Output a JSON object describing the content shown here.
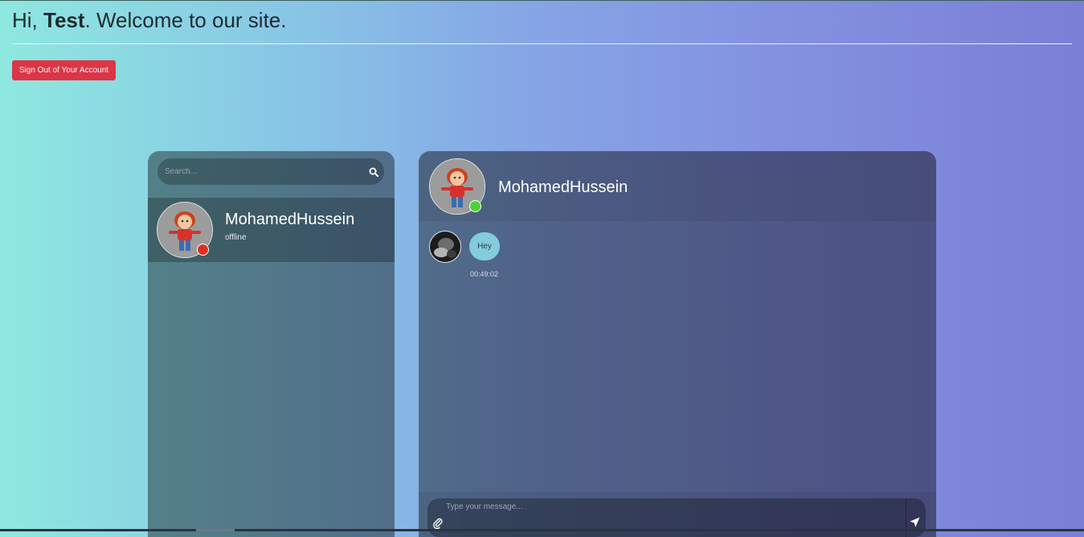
{
  "header": {
    "greeting_prefix": "Hi, ",
    "username": "Test",
    "greeting_suffix": ". Welcome to our site."
  },
  "signout_label": "Sign Out of Your Account",
  "contacts": {
    "search_placeholder": "Search...",
    "items": [
      {
        "name": "MohamedHussein",
        "status": "offline",
        "status_color": "#d9331f"
      }
    ]
  },
  "chat": {
    "contact_name": "MohamedHussein",
    "online_color": "#4cd137",
    "messages": [
      {
        "text": "Hey",
        "time": "00:49:02"
      }
    ],
    "input_placeholder": "Type your message..."
  },
  "colors": {
    "signout": "#dc3545",
    "bubble": "#82ccdd"
  },
  "icons": [
    "search-icon",
    "paperclip-icon",
    "send-icon"
  ]
}
